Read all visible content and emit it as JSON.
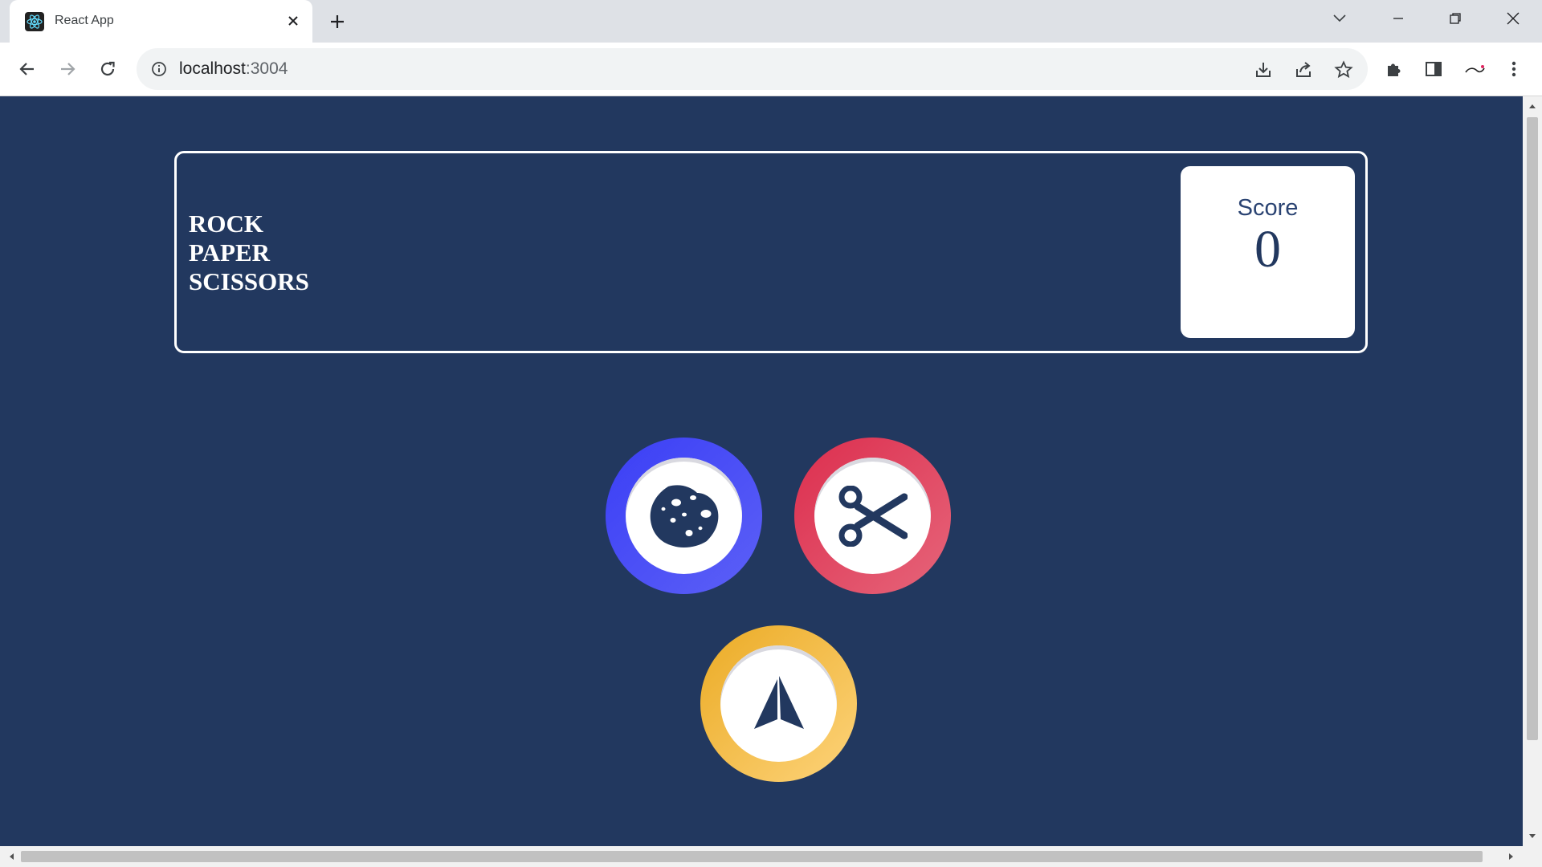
{
  "browser": {
    "tab_title": "React App",
    "url_host": "localhost",
    "url_port": ":3004"
  },
  "game": {
    "title_lines": [
      "ROCK",
      "PAPER",
      "SCISSORS"
    ],
    "score_label": "Score",
    "score_value": "0",
    "choices": [
      {
        "name": "rock",
        "icon": "rock-icon",
        "ring_color": "#4044f5"
      },
      {
        "name": "scissors",
        "icon": "scissors-icon",
        "ring_color": "#e04362"
      },
      {
        "name": "paper",
        "icon": "paper-plane-icon",
        "ring_color": "#f2b940"
      }
    ],
    "colors": {
      "background": "#22385f",
      "icon": "#22385f"
    }
  }
}
